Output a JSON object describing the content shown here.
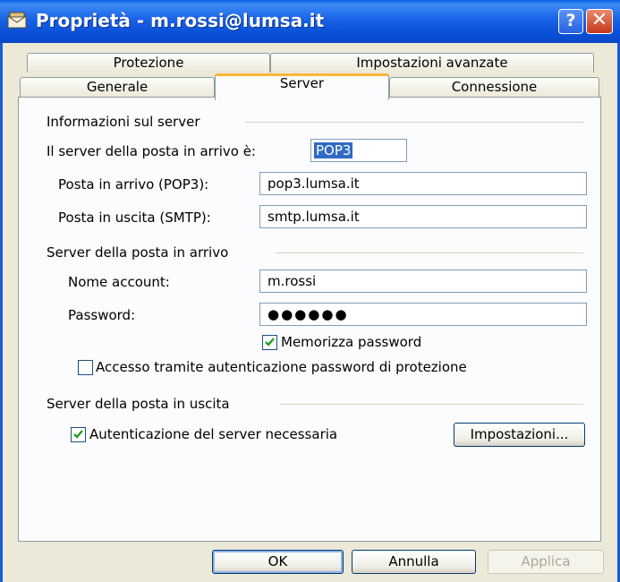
{
  "window": {
    "title": "Proprietà - m.rossi@lumsa.it",
    "help_label": "?",
    "close_label": "✕"
  },
  "tabs": {
    "row1": [
      "Protezione",
      "Impostazioni avanzate"
    ],
    "row2": [
      "Generale",
      "Server",
      "Connessione"
    ],
    "active": "Server"
  },
  "server_info": {
    "section_title": "Informazioni sul server",
    "incoming_type_label": "Il server della posta in arrivo è:",
    "incoming_type_value": "POP3",
    "incoming_label": "Posta in arrivo (POP3):",
    "incoming_value": "pop3.lumsa.it",
    "outgoing_label": "Posta in uscita (SMTP):",
    "outgoing_value": "smtp.lumsa.it"
  },
  "incoming_server": {
    "section_title": "Server della posta in arrivo",
    "account_label": "Nome account:",
    "account_value": "m.rossi",
    "password_label": "Password:",
    "password_value": "●●●●●●",
    "remember_label": "Memorizza password",
    "remember_checked": true,
    "spa_label": "Accesso tramite autenticazione password di protezione",
    "spa_checked": false
  },
  "outgoing_server": {
    "section_title": "Server della posta in uscita",
    "auth_label": "Autenticazione del server necessaria",
    "auth_checked": true,
    "settings_button": "Impostazioni..."
  },
  "footer": {
    "ok": "OK",
    "cancel": "Annulla",
    "apply": "Applica"
  },
  "colors": {
    "titlebar": "#0a4fd6",
    "accent_tab": "#f7b63c",
    "selection": "#316ac5",
    "dialog_bg": "#ece9d8"
  }
}
